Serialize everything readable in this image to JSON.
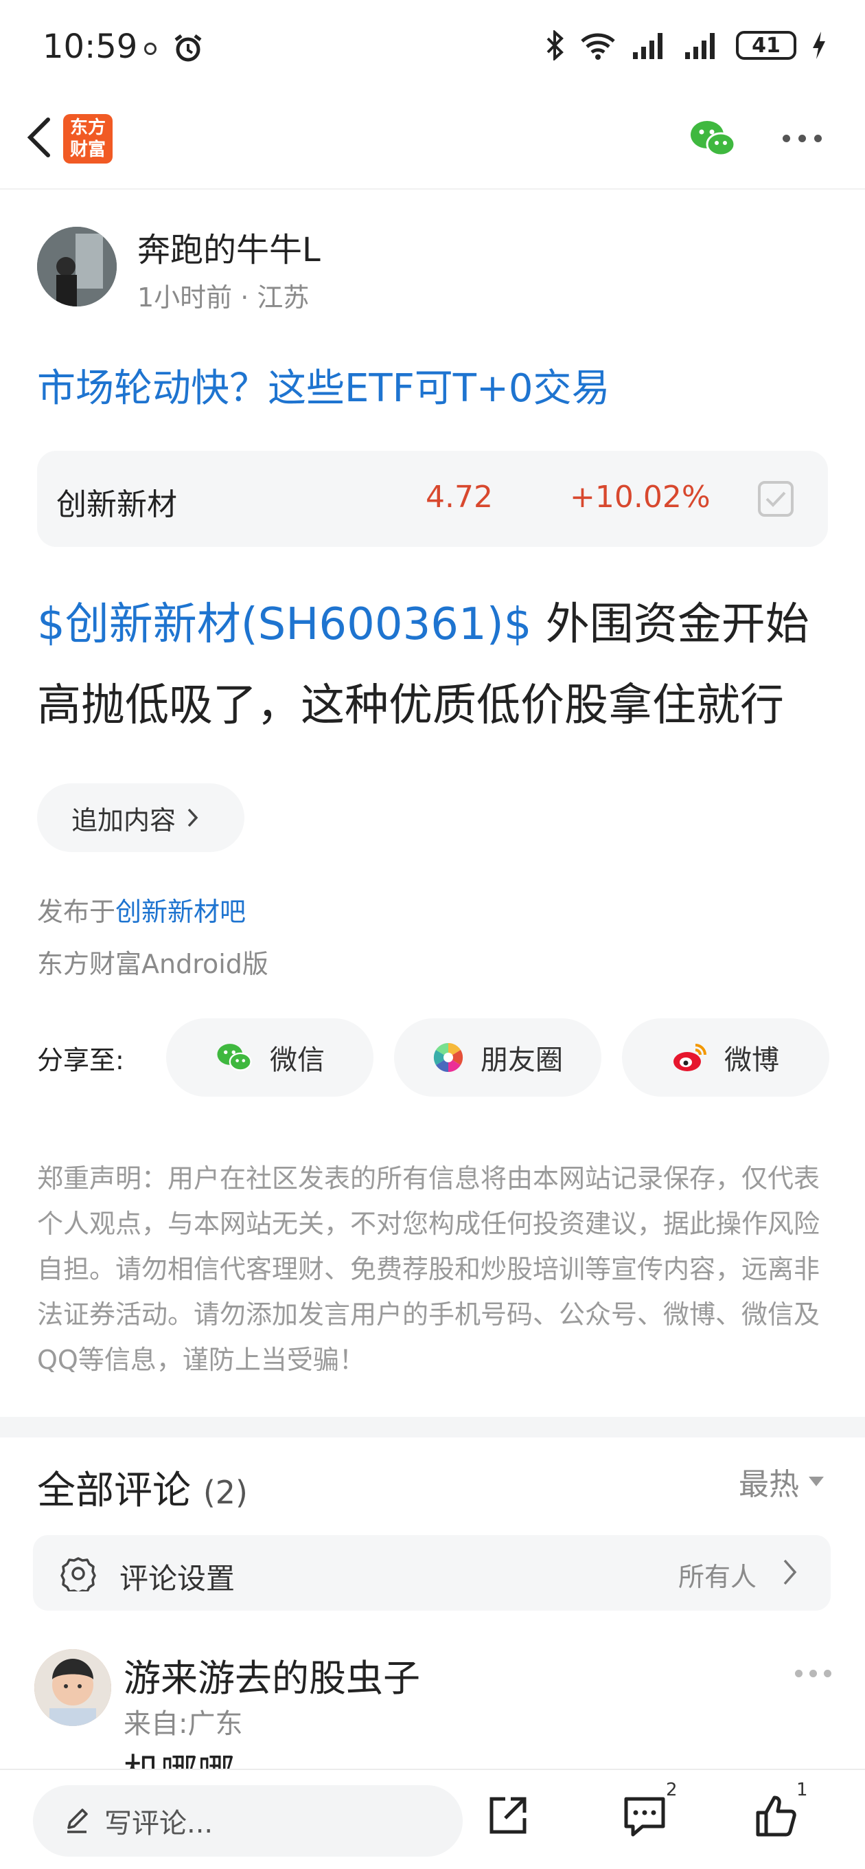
{
  "status_bar": {
    "time": "10:59",
    "battery": "41"
  },
  "nav": {
    "brand_text": "东方财富"
  },
  "author": {
    "name": "奔跑的牛牛L",
    "meta": "1小时前 · 江苏"
  },
  "post": {
    "title": "市场轮动快？这些ETF可T+0交易",
    "stock_card": {
      "name": "创新新材",
      "price": "4.72",
      "change": "+10.02%"
    },
    "body_link": "$创新新材(SH600361)$",
    "body_text": " 外围资金开始高抛低吸了，这种优质低价股拿住就行",
    "append_label": "追加内容",
    "published_prefix": "发布于",
    "published_bar": "创新新材吧",
    "client": "东方财富Android版"
  },
  "share": {
    "label": "分享至:",
    "wechat": "微信",
    "moments": "朋友圈",
    "weibo": "微博"
  },
  "disclaimer": "郑重声明：用户在社区发表的所有信息将由本网站记录保存，仅代表个人观点，与本网站无关，不对您构成任何投资建议，据此操作风险自担。请勿相信代客理财、免费荐股和炒股培训等宣传内容，远离非法证券活动。请勿添加发言用户的手机号码、公众号、微博、微信及QQ等信息，谨防上当受骗！",
  "comments": {
    "title": "全部评论",
    "count": "(2)",
    "sort": "最热",
    "settings_label": "评论设置",
    "settings_value": "所有人",
    "items": [
      {
        "name": "游来游去的股虫子",
        "location": "来自:广东",
        "text": "机哪哪"
      }
    ]
  },
  "bottom_bar": {
    "write_placeholder": "写评论...",
    "comment_badge": "2",
    "like_badge": "1"
  },
  "colors": {
    "link_blue": "#1e74d0",
    "up_red": "#d8482e",
    "brand_orange": "#f15a24"
  }
}
